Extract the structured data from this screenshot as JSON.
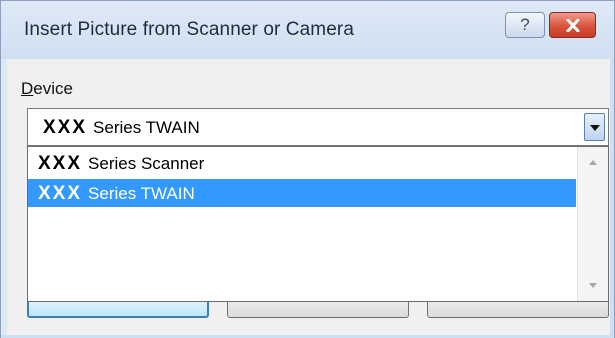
{
  "window": {
    "title": "Insert Picture from Scanner or Camera",
    "help_glyph": "?",
    "close_icon": "close-icon"
  },
  "device": {
    "label_prefix": "D",
    "label_rest": "evice",
    "selected_brand": "XXX",
    "selected_name": "Series TWAIN",
    "options": [
      {
        "brand": "XXX",
        "name": "Series Scanner",
        "selected": false
      },
      {
        "brand": "XXX",
        "name": "Series TWAIN",
        "selected": true
      }
    ]
  },
  "colors": {
    "selection": "#3399ff",
    "titlebar": "#dfe9f6",
    "close_button": "#d9543b"
  }
}
